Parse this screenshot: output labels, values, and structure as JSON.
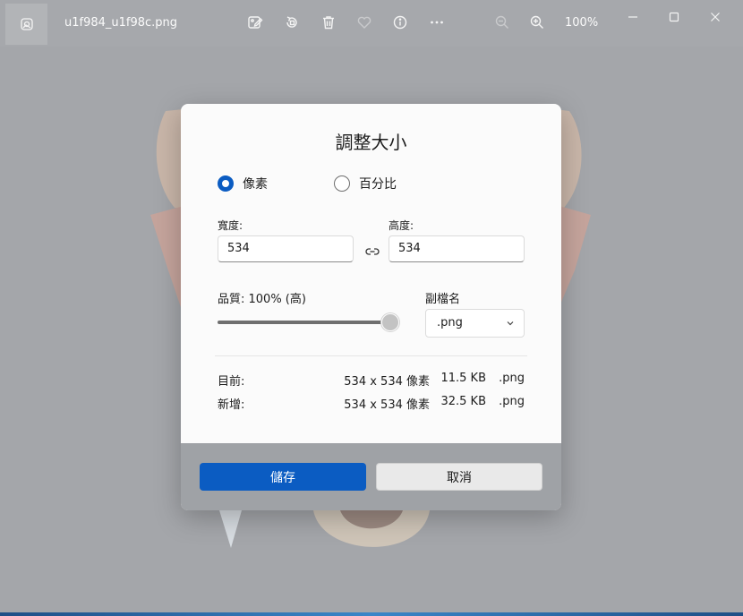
{
  "titlebar": {
    "filename": "u1f984_u1f98c.png",
    "zoom": "100%",
    "icons": [
      "image-app-icon",
      "edit-image-icon",
      "rotate-icon",
      "delete-icon",
      "favorite-icon",
      "info-icon",
      "more-icon",
      "zoom-out-icon",
      "zoom-in-icon"
    ],
    "window_controls": [
      "minimize-icon",
      "maximize-icon",
      "close-icon"
    ]
  },
  "dialog": {
    "title": "調整大小",
    "mode_options": [
      "像素",
      "百分比"
    ],
    "selected_mode": "像素",
    "width_label": "寬度:",
    "width_value": "534",
    "height_label": "高度:",
    "height_value": "534",
    "lock_icon": "link-icon",
    "quality_label": "品質: 100% (高)",
    "quality_value": 100,
    "extension_label": "副檔名",
    "extension_value": ".png",
    "current": {
      "label": "目前:",
      "dimensions": "534 x 534 像素",
      "size": "11.5 KB",
      "ext": ".png"
    },
    "new": {
      "label": "新增:",
      "dimensions": "534 x 534 像素",
      "size": "32.5 KB",
      "ext": ".png"
    },
    "save_button": "儲存",
    "cancel_button": "取消"
  },
  "colors": {
    "accent": "#0b5cc2",
    "overlay": "#a4a6aa"
  }
}
